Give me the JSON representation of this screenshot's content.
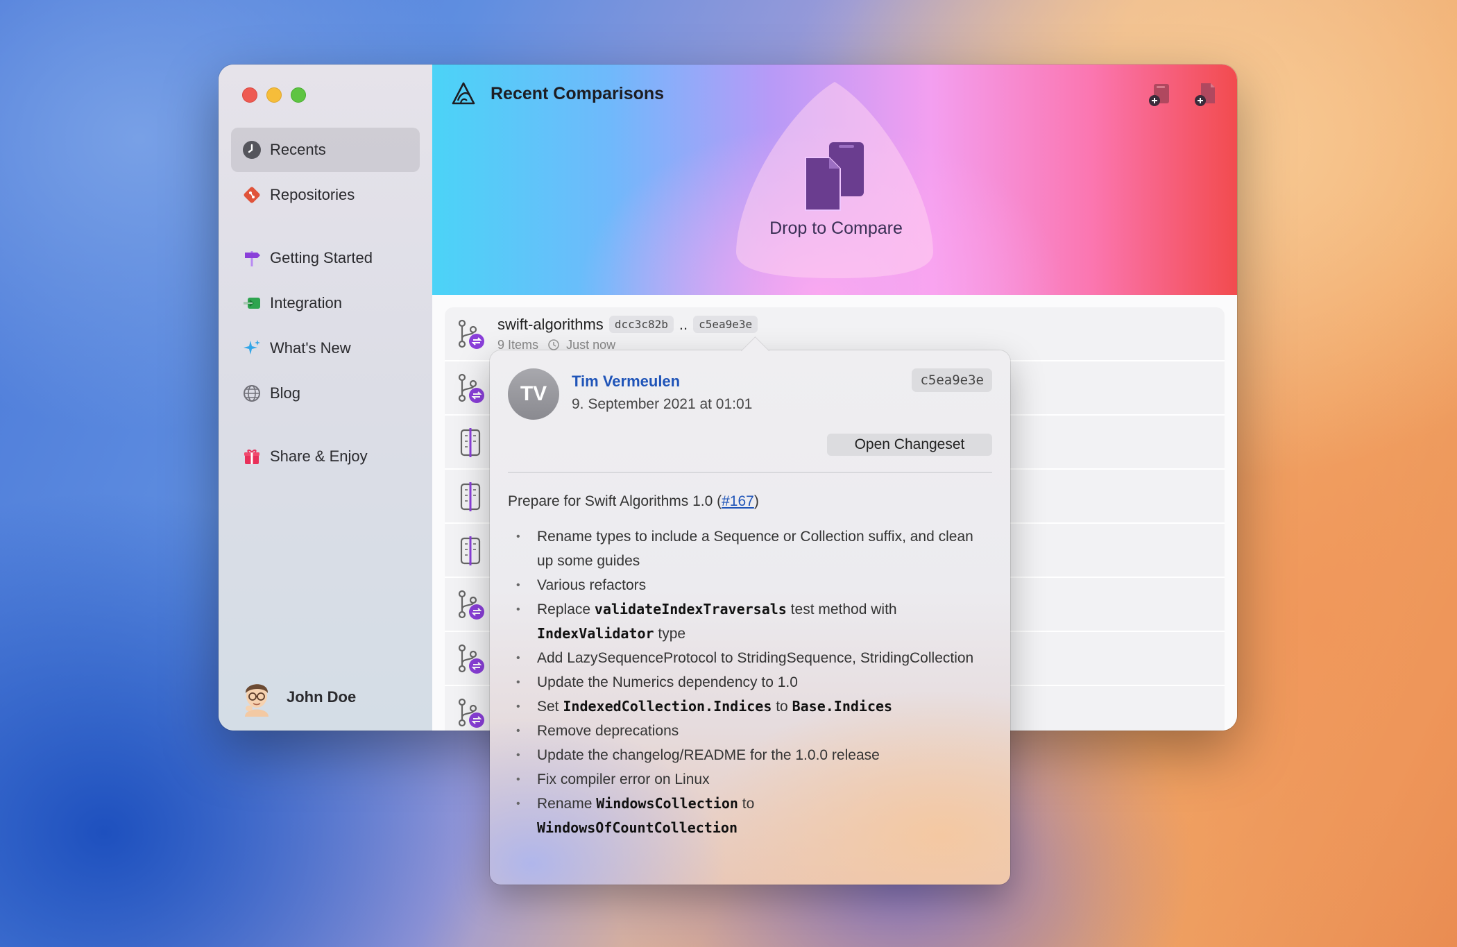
{
  "sidebar": {
    "items": [
      {
        "label": "Recents",
        "icon": "clock-icon",
        "active": true
      },
      {
        "label": "Repositories",
        "icon": "git-diamond-icon"
      },
      {
        "label": "Getting Started",
        "icon": "signpost-icon"
      },
      {
        "label": "Integration",
        "icon": "integration-icon"
      },
      {
        "label": "What's New",
        "icon": "sparkles-icon"
      },
      {
        "label": "Blog",
        "icon": "globe-icon"
      },
      {
        "label": "Share & Enjoy",
        "icon": "gift-icon"
      }
    ],
    "user": {
      "name": "John Doe"
    }
  },
  "header": {
    "title": "Recent Comparisons",
    "drop_label": "Drop to Compare"
  },
  "rows": [
    {
      "title": "swift-algorithms",
      "from": "dcc3c82b",
      "separator": "..",
      "to": "c5ea9e3e",
      "items": "9 Items",
      "time": "Just now"
    }
  ],
  "popover": {
    "initials": "TV",
    "author": "Tim Vermeulen",
    "date": "9. September 2021 at 01:01",
    "hash": "c5ea9e3e",
    "button": "Open Changeset",
    "heading_prefix": "Prepare for Swift Algorithms 1.0 (",
    "heading_link": "#167",
    "heading_suffix": ")",
    "bullets": {
      "b1": "Rename types to include a Sequence or Collection suffix, and clean up some guides",
      "b2": "Various refactors",
      "b3_a": "Replace ",
      "b3_code1": "validateIndexTraversals",
      "b3_b": " test method with ",
      "b3_code2": "IndexValidator",
      "b3_c": " type",
      "b4": "Add LazySequenceProtocol to StridingSequence, StridingCollection",
      "b5": "Update the Numerics dependency to 1.0",
      "b6_a": "Set ",
      "b6_code1": "IndexedCollection.Indices",
      "b6_b": " to ",
      "b6_code2": "Base.Indices",
      "b7": "Remove deprecations",
      "b8": "Update the changelog/README for the 1.0.0 release",
      "b9": "Fix compiler error on Linux",
      "b10_a": "Rename ",
      "b10_code1": "WindowsCollection",
      "b10_b": " to ",
      "b10_code2": "WindowsOfCountCollection"
    }
  },
  "colors": {
    "accent_purple": "#8a3fd9",
    "link_blue": "#1f54b8"
  }
}
